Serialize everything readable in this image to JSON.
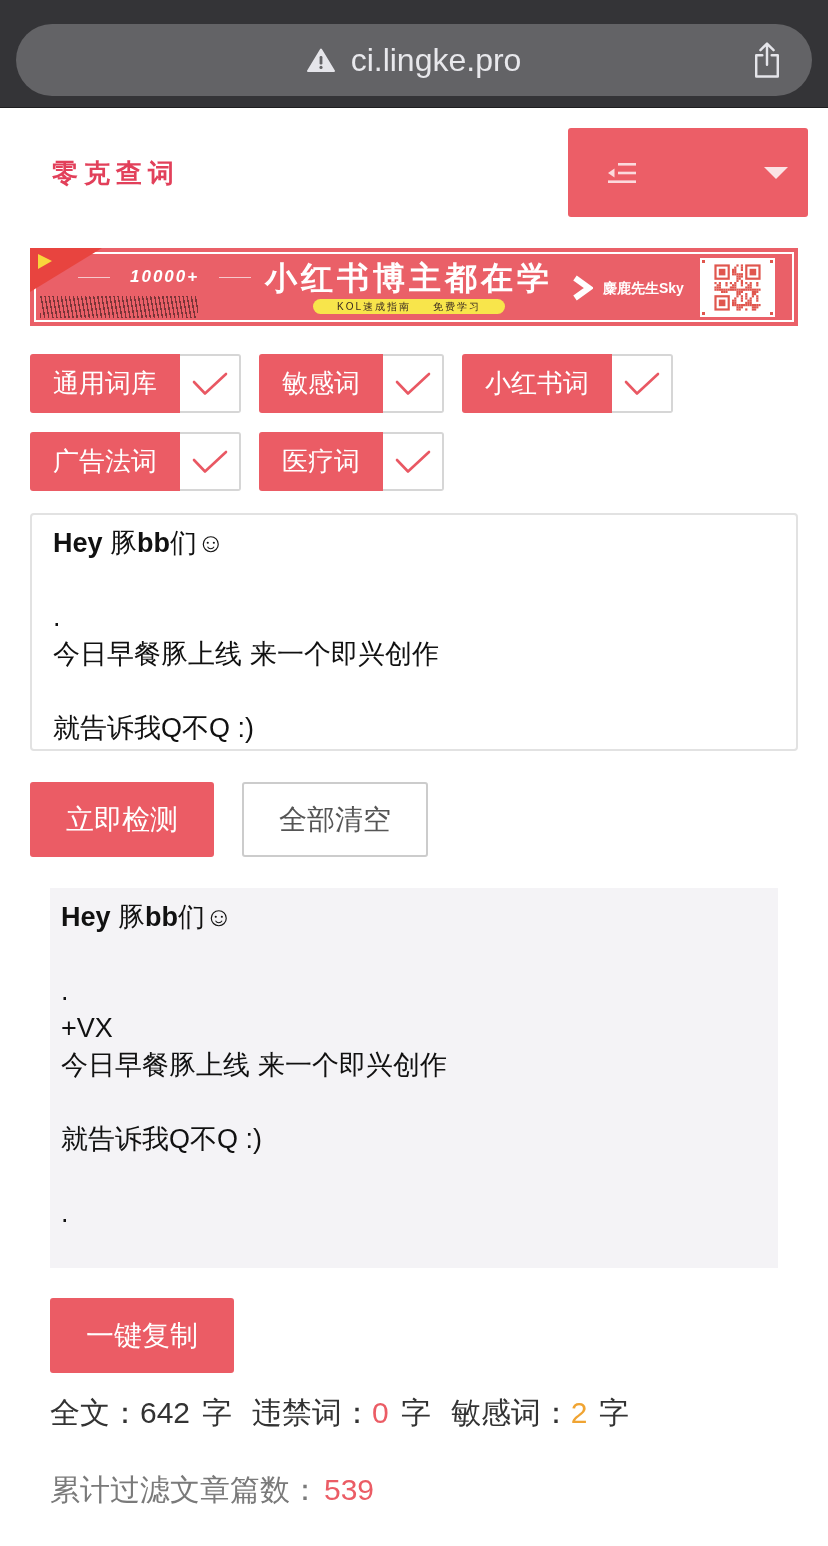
{
  "browser": {
    "secure": false,
    "url": "ci.lingke.pro"
  },
  "header": {
    "logo": "零克查词"
  },
  "banner": {
    "count": "10000+",
    "headline": "小红书博主都在学",
    "tags": [
      "KOL速成指南",
      "免费学习"
    ],
    "author": "麋鹿先生Sky"
  },
  "word_banks": [
    {
      "label": "通用词库",
      "checked": true
    },
    {
      "label": "敏感词",
      "checked": true
    },
    {
      "label": "小红书词",
      "checked": true
    },
    {
      "label": "广告法词",
      "checked": true
    },
    {
      "label": "医疗词",
      "checked": true
    }
  ],
  "input": {
    "paragraphs": [
      [
        "**Hey** 豚**bb**们☺"
      ],
      [
        ".",
        "今日早餐豚上线 来一个即兴创作"
      ],
      [
        "就告诉我Q不Q :)"
      ]
    ]
  },
  "actions": [
    {
      "label": "立即检测",
      "kind": "primary"
    },
    {
      "label": "全部清空",
      "kind": "secondary"
    }
  ],
  "result": {
    "paragraphs": [
      [
        "**Hey** 豚**bb**们☺"
      ],
      [
        ".",
        "+VX",
        "今日早餐豚上线 来一个即兴创作"
      ],
      [
        "就告诉我Q不Q :)"
      ],
      [
        "."
      ]
    ]
  },
  "copy_button": {
    "label": "一键复制"
  },
  "stats": [
    {
      "label": "全文：",
      "value": "642",
      "unit": "字",
      "color": "#333333"
    },
    {
      "label": "违禁词：",
      "value": "0",
      "unit": "字",
      "color": "#eb5c65"
    },
    {
      "label": "敏感词：",
      "value": "2",
      "unit": "字",
      "color": "#f0a432"
    }
  ],
  "total_filtered": {
    "label": "累计过滤文章篇数：",
    "value": "539"
  }
}
